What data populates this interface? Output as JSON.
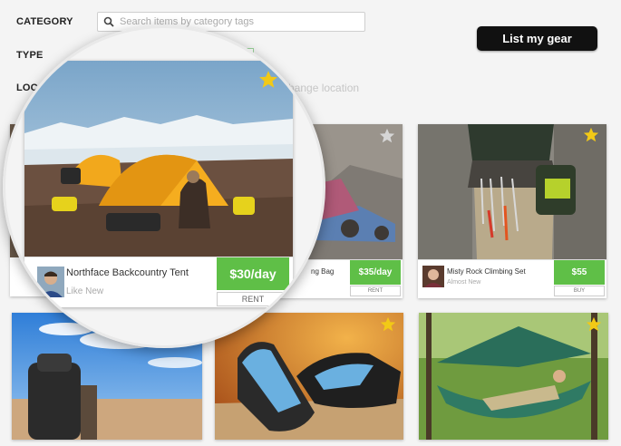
{
  "filters": {
    "category_label": "CATEGORY",
    "type_label": "TYPE",
    "location_label": "LOC",
    "search_placeholder": "Search items by category tags",
    "change_location": "change location"
  },
  "list_button": "List my gear",
  "colors": {
    "accent_green": "#5fbf47",
    "star_gold": "#f2c916",
    "button_black": "#111111"
  },
  "featured": {
    "title": "Northface Backcountry Tent",
    "condition": "Like New",
    "price": "$30/day",
    "action": "RENT",
    "icon": "star-icon"
  },
  "listings": [
    {
      "title": "ng Bag",
      "price": "$35/day",
      "action": "RENT",
      "favorited": false
    },
    {
      "title": "Misty Rock Climbing Set",
      "condition": "Almost New",
      "price": "$55",
      "action": "BUY",
      "favorited": true
    }
  ],
  "bottom_row": [
    {
      "subject": "backpacker in desert",
      "favorited": false
    },
    {
      "subject": "climbing shoes",
      "favorited": true
    },
    {
      "subject": "hammock tent",
      "favorited": true
    }
  ]
}
